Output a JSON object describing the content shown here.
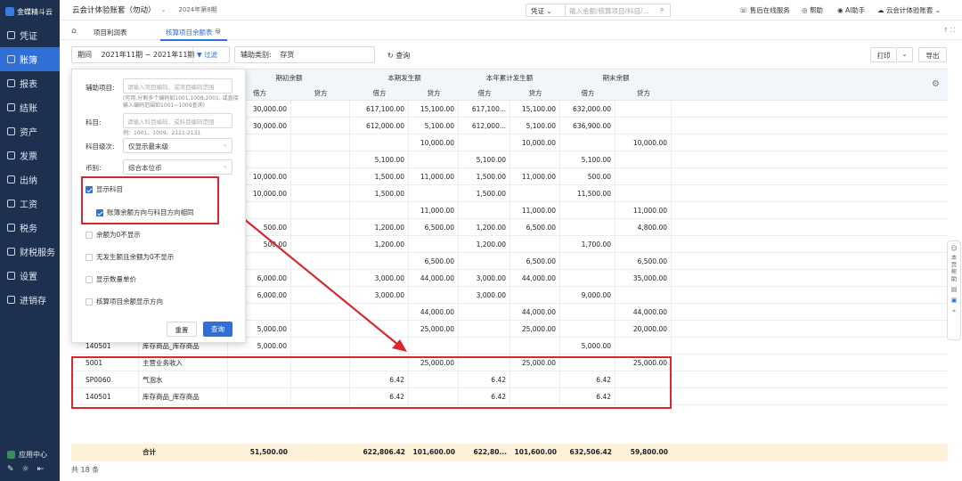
{
  "sidebar": {
    "logo": "金蝶精斗云",
    "items": [
      {
        "label": "凭证",
        "icon": "doc-icon",
        "active": false
      },
      {
        "label": "账簿",
        "icon": "book-icon",
        "active": true
      },
      {
        "label": "报表",
        "icon": "report-icon",
        "active": false
      },
      {
        "label": "结账",
        "icon": "doc-icon",
        "active": false
      },
      {
        "label": "资产",
        "icon": "asset-icon",
        "active": false
      },
      {
        "label": "发票",
        "icon": "invoice-icon",
        "active": false
      },
      {
        "label": "出纳",
        "icon": "cash-icon",
        "active": false
      },
      {
        "label": "工资",
        "icon": "salary-icon",
        "active": false
      },
      {
        "label": "税务",
        "icon": "tax-icon",
        "active": false
      },
      {
        "label": "财税服务",
        "icon": "service-icon",
        "active": false
      },
      {
        "label": "设置",
        "icon": "gear-icon",
        "active": false
      },
      {
        "label": "进销存",
        "icon": "inventory-icon",
        "active": false
      }
    ],
    "app_center": "应用中心"
  },
  "topbar": {
    "account_name": "云会计体验账套（勿动）",
    "period": "2024年第8期",
    "voucher_select": "凭证",
    "search_placeholder": "输入金额/核算项目/科目/...",
    "links": {
      "service": "售后在线服务",
      "help": "帮助",
      "ai": "AI助手",
      "user": "云会计体验账套"
    }
  },
  "tabs": {
    "items": [
      {
        "label": "项目利润表",
        "active": false
      },
      {
        "label": "核算项目余额表",
        "active": true
      }
    ]
  },
  "filter_bar": {
    "period_label": "期间",
    "period_value": "2021年11期 ~ 2021年11期",
    "filter_label": "过滤",
    "aux_label": "辅助类别:",
    "aux_value": "存货",
    "query_label": "查询",
    "print_label": "打印",
    "export_label": "导出"
  },
  "popover": {
    "aux_item_label": "辅助项目:",
    "aux_item_placeholder": "请输入项目编码、或项目编码范围",
    "aux_item_hint": "(可用,分割多个编码如1001,1008,2001, 或直接输入编码范围如1001~1009查询)",
    "subject_label": "科目:",
    "subject_placeholder": "请输入科目编码、或科目编码范围",
    "subject_hint": "例：1001、1009、2121-2131",
    "level_label": "科目级次:",
    "level_value": "仅显示最末级",
    "currency_label": "币别:",
    "currency_value": "综合本位币",
    "checks": [
      {
        "label": "显示科目",
        "checked": true
      },
      {
        "label": "账簿余额方向与科目方向相同",
        "checked": true
      },
      {
        "label": "余额为0不显示",
        "checked": false
      },
      {
        "label": "无发生额且余额为0不显示",
        "checked": false
      },
      {
        "label": "显示数量单价",
        "checked": false
      },
      {
        "label": "核算项目余额显示方向",
        "checked": false
      }
    ],
    "reset_label": "重置",
    "query_label": "查询"
  },
  "table": {
    "group_headers": [
      "期初余额",
      "本期发生额",
      "本年累计发生额",
      "期末余额"
    ],
    "sub_headers": [
      "借方",
      "贷方",
      "借方",
      "贷方",
      "借方",
      "贷方",
      "借方",
      "贷方"
    ],
    "rows": [
      {
        "code": "",
        "name": "",
        "v": [
          "30,000.00",
          "",
          "617,100.00",
          "15,100.00",
          "617,100...",
          "15,100.00",
          "632,000.00",
          ""
        ]
      },
      {
        "code": "",
        "name": "",
        "v": [
          "30,000.00",
          "",
          "612,000.00",
          "5,100.00",
          "612,000...",
          "5,100.00",
          "636,900.00",
          ""
        ]
      },
      {
        "code": "",
        "name": "",
        "v": [
          "",
          "",
          "",
          "10,000.00",
          "",
          "10,000.00",
          "",
          "10,000.00"
        ]
      },
      {
        "code": "",
        "name": "",
        "v": [
          "",
          "",
          "5,100.00",
          "",
          "5,100.00",
          "",
          "5,100.00",
          ""
        ]
      },
      {
        "code": "",
        "name": "",
        "v": [
          "10,000.00",
          "",
          "1,500.00",
          "11,000.00",
          "1,500.00",
          "11,000.00",
          "500.00",
          ""
        ]
      },
      {
        "code": "",
        "name": "",
        "v": [
          "10,000.00",
          "",
          "1,500.00",
          "",
          "1,500.00",
          "",
          "11,500.00",
          ""
        ]
      },
      {
        "code": "",
        "name": "",
        "v": [
          "",
          "",
          "",
          "11,000.00",
          "",
          "11,000.00",
          "",
          "11,000.00"
        ]
      },
      {
        "code": "",
        "name": "",
        "v": [
          "500.00",
          "",
          "1,200.00",
          "6,500.00",
          "1,200.00",
          "6,500.00",
          "",
          "4,800.00"
        ]
      },
      {
        "code": "",
        "name": "",
        "v": [
          "500.00",
          "",
          "1,200.00",
          "",
          "1,200.00",
          "",
          "1,700.00",
          ""
        ]
      },
      {
        "code": "",
        "name": "",
        "v": [
          "",
          "",
          "",
          "6,500.00",
          "",
          "6,500.00",
          "",
          "6,500.00"
        ]
      },
      {
        "code": "",
        "name": "",
        "v": [
          "6,000.00",
          "",
          "3,000.00",
          "44,000.00",
          "3,000.00",
          "44,000.00",
          "",
          "35,000.00"
        ]
      },
      {
        "code": "",
        "name": "",
        "v": [
          "6,000.00",
          "",
          "3,000.00",
          "",
          "3,000.00",
          "",
          "9,000.00",
          ""
        ]
      },
      {
        "code": "",
        "name": "",
        "v": [
          "",
          "",
          "",
          "44,000.00",
          "",
          "44,000.00",
          "",
          "44,000.00"
        ]
      },
      {
        "code": "",
        "name": "",
        "v": [
          "5,000.00",
          "",
          "",
          "25,000.00",
          "",
          "25,000.00",
          "",
          "20,000.00"
        ]
      },
      {
        "code": "140501",
        "name": "库存商品_库存商品",
        "v": [
          "5,000.00",
          "",
          "",
          "",
          "",
          "",
          "5,000.00",
          ""
        ]
      },
      {
        "code": "5001",
        "name": "主营业务收入",
        "v": [
          "",
          "",
          "",
          "25,000.00",
          "",
          "25,000.00",
          "",
          "25,000.00"
        ]
      },
      {
        "code": "SP0060",
        "name": "气泡水",
        "v": [
          "",
          "",
          "6.42",
          "",
          "6.42",
          "",
          "6.42",
          ""
        ]
      },
      {
        "code": "140501",
        "name": "库存商品_库存商品",
        "v": [
          "",
          "",
          "6.42",
          "",
          "6.42",
          "",
          "6.42",
          ""
        ]
      }
    ],
    "total": {
      "label": "合计",
      "v": [
        "51,500.00",
        "",
        "622,806.42",
        "101,600.00",
        "622,80...",
        "101,600.00",
        "632,506.42",
        "59,800.00"
      ]
    },
    "count_text": "共 18 条"
  },
  "float_panel": {
    "help_label": "本页帮助"
  }
}
